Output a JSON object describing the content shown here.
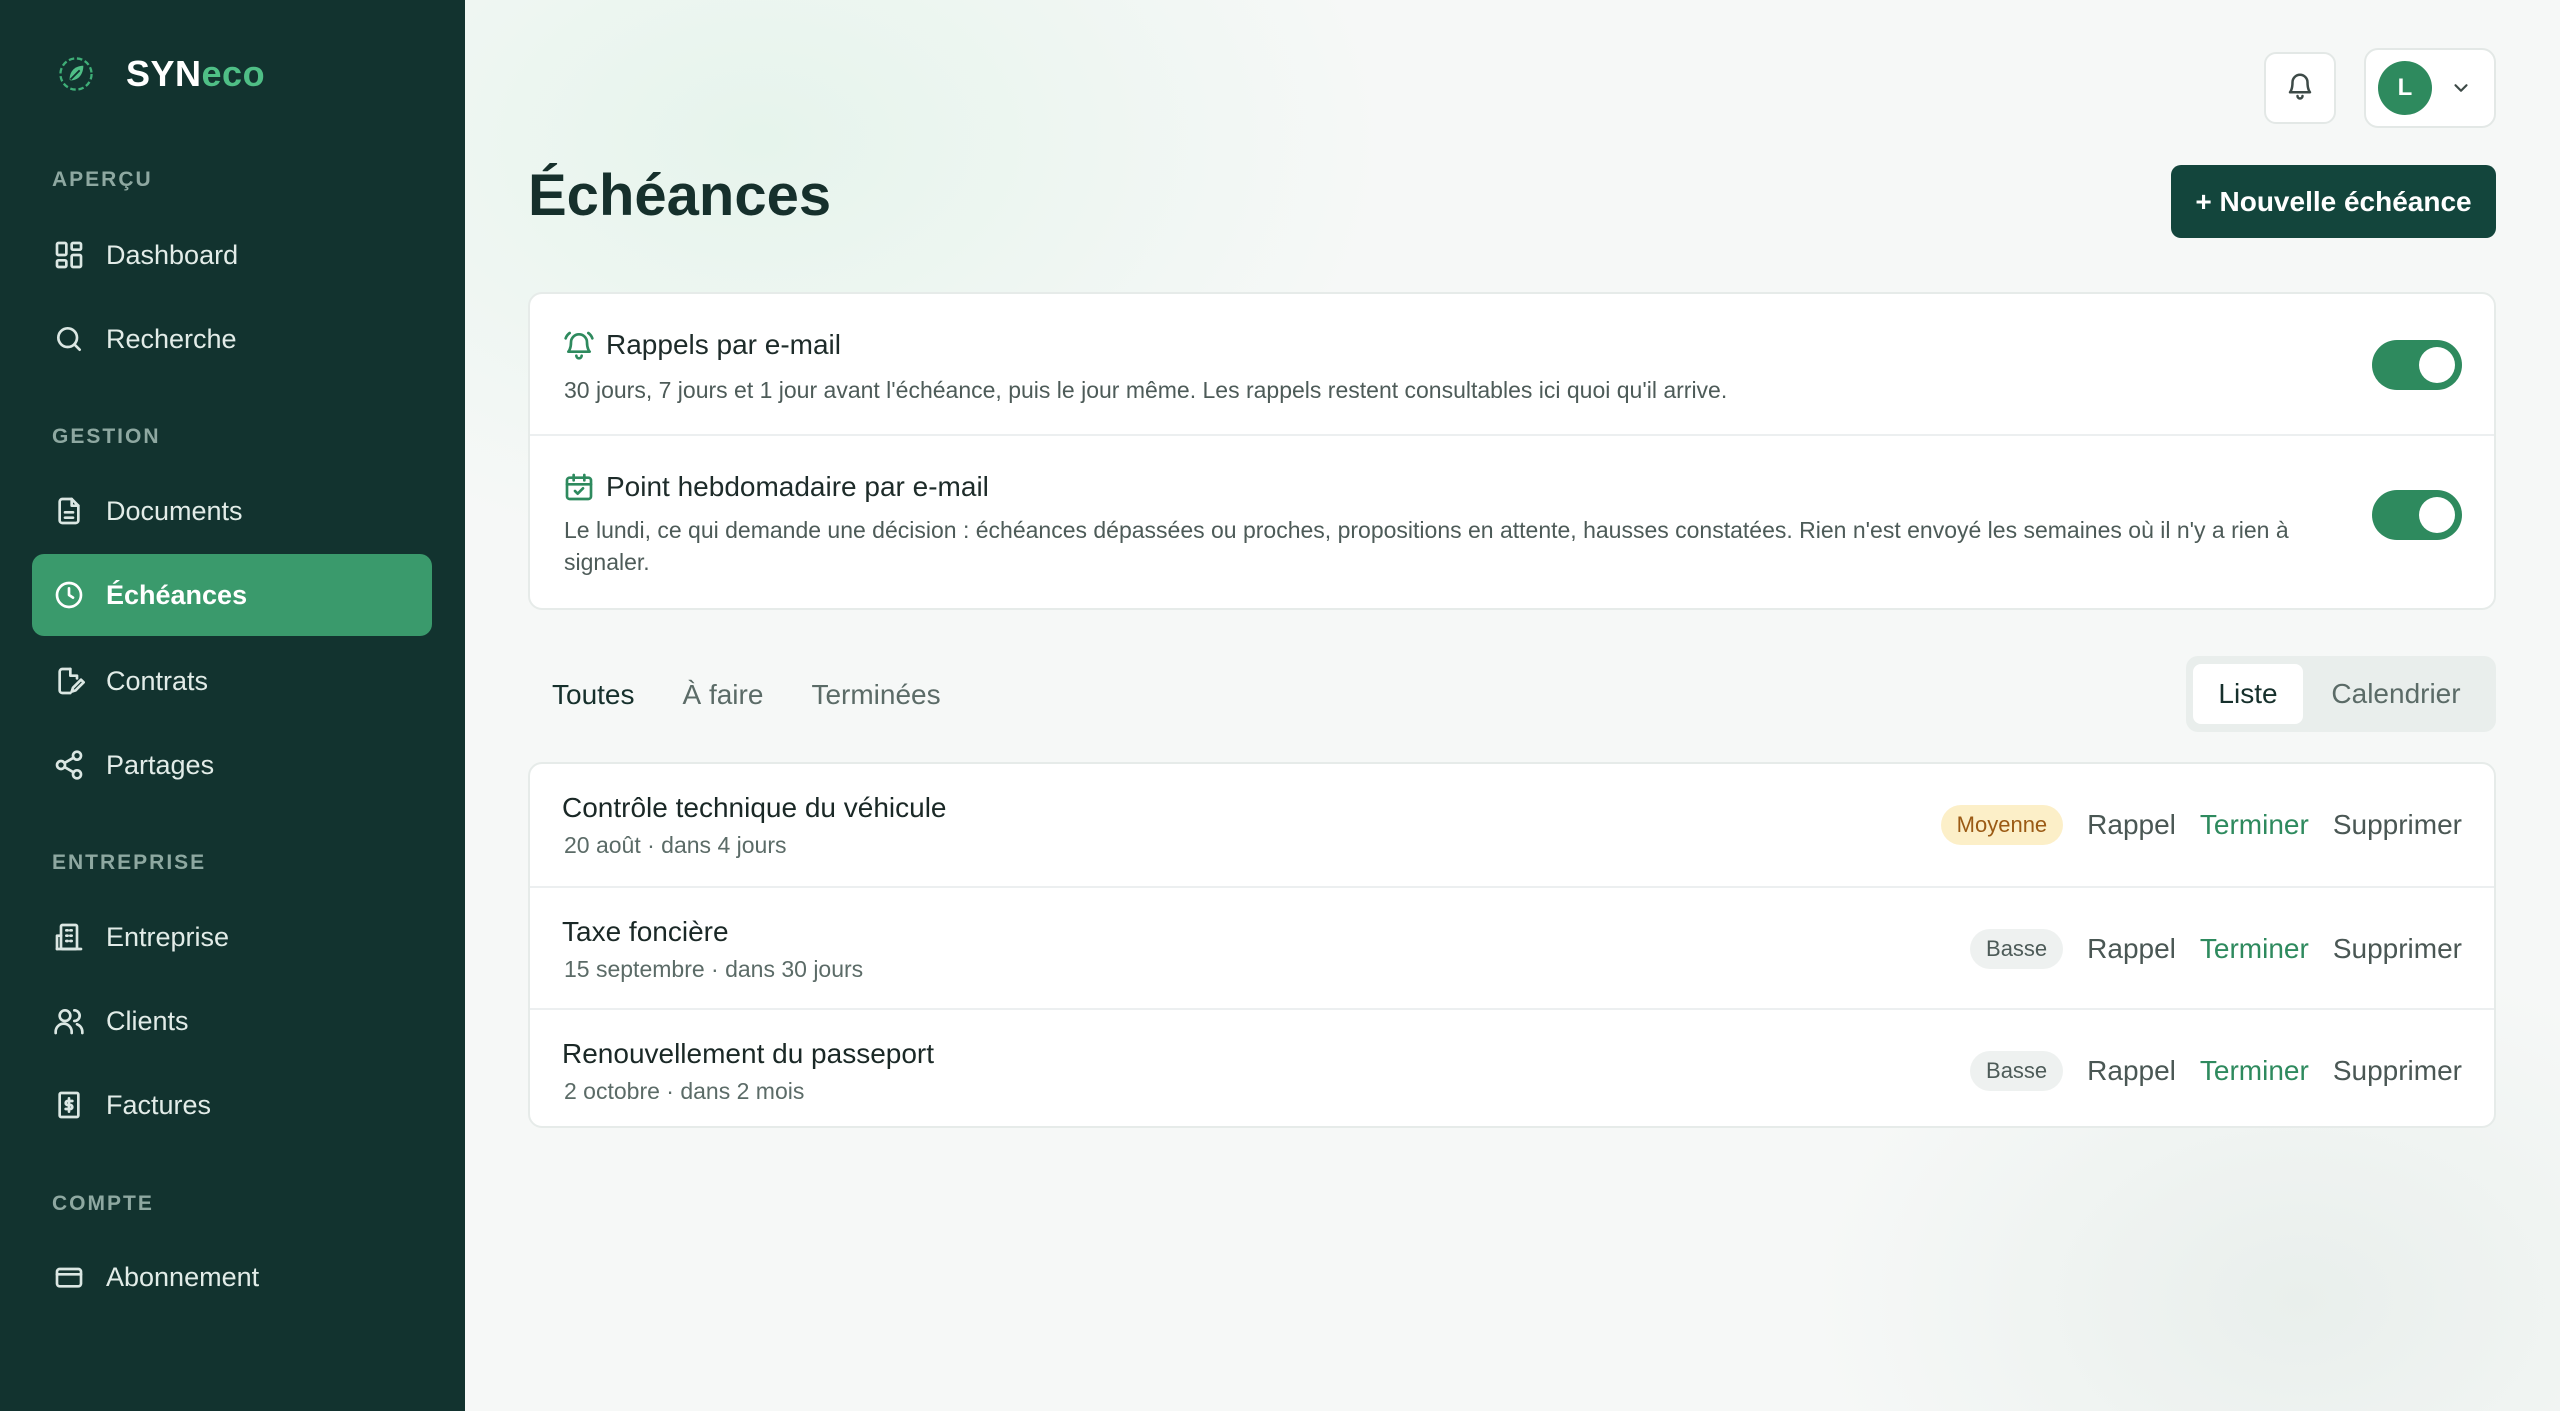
{
  "brand": {
    "name_part1": "SYN",
    "name_part2": "eco"
  },
  "sidebar": {
    "sections": [
      {
        "label": "APERÇU"
      },
      {
        "label": "GESTION"
      },
      {
        "label": "ENTREPRISE"
      },
      {
        "label": "COMPTE"
      }
    ],
    "items": [
      {
        "label": "Dashboard",
        "icon": "dashboard-icon"
      },
      {
        "label": "Recherche",
        "icon": "search-icon"
      },
      {
        "label": "Documents",
        "icon": "document-icon"
      },
      {
        "label": "Échéances",
        "icon": "clock-icon",
        "active": true
      },
      {
        "label": "Contrats",
        "icon": "contract-edit-icon"
      },
      {
        "label": "Partages",
        "icon": "share-icon"
      },
      {
        "label": "Entreprise",
        "icon": "building-icon"
      },
      {
        "label": "Clients",
        "icon": "users-icon"
      },
      {
        "label": "Factures",
        "icon": "invoice-icon"
      },
      {
        "label": "Abonnement",
        "icon": "credit-card-icon"
      }
    ]
  },
  "header": {
    "user_initial": "L",
    "title": "Échéances",
    "new_button": "+ Nouvelle échéance"
  },
  "settings": {
    "email_reminders": {
      "title": "Rappels par e-mail",
      "description": "30 jours, 7 jours et 1 jour avant l'échéance, puis le jour même. Les rappels restent consultables ici quoi qu'il arrive.",
      "enabled": true
    },
    "weekly_digest": {
      "title": "Point hebdomadaire par e-mail",
      "description": "Le lundi, ce qui demande une décision : échéances dépassées ou proches, propositions en attente, hausses constatées. Rien n'est envoyé les semaines où il n'y a rien à signaler.",
      "enabled": true
    }
  },
  "tabs": [
    {
      "label": "Toutes",
      "active": true
    },
    {
      "label": "À faire"
    },
    {
      "label": "Terminées"
    }
  ],
  "view_switch": {
    "list": "Liste",
    "calendar": "Calendrier",
    "selected": "Liste"
  },
  "deadlines": [
    {
      "title": "Contrôle technique du véhicule",
      "subtitle": "20 août · dans 4 jours",
      "priority": "Moyenne"
    },
    {
      "title": "Taxe foncière",
      "subtitle": "15 septembre · dans 30 jours",
      "priority": "Basse"
    },
    {
      "title": "Renouvellement du passeport",
      "subtitle": "2 octobre · dans 2 mois",
      "priority": "Basse"
    }
  ],
  "actions": {
    "reminder": "Rappel",
    "complete": "Terminer",
    "delete": "Supprimer"
  },
  "colors": {
    "sidebar_bg": "#12332f",
    "accent": "#2e8a5e",
    "active_nav": "#3a9a6c",
    "primary_button": "#13453c",
    "badge_medium_bg": "#fcefc8",
    "badge_medium_text": "#9b5a14"
  }
}
